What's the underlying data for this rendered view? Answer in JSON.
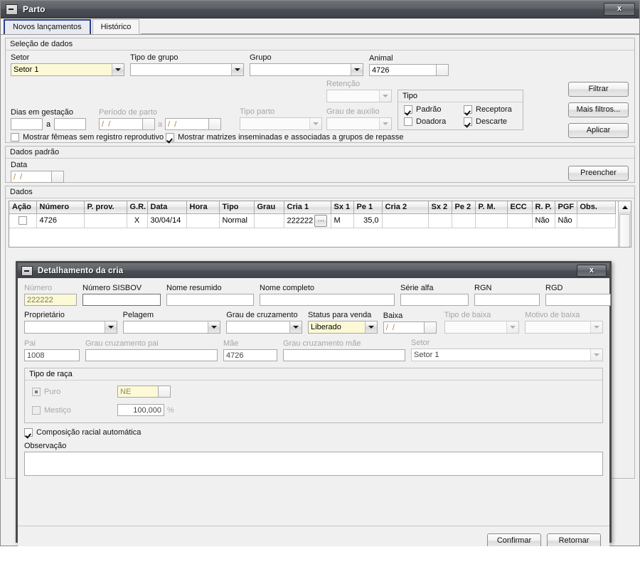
{
  "window": {
    "title": "Parto",
    "close_label": "x",
    "minimize_icon": "minimize-icon"
  },
  "tabs": [
    {
      "label": "Novos lançamentos",
      "active": true
    },
    {
      "label": "Histórico",
      "active": false
    }
  ],
  "selecao_de_dados": {
    "title": "Seleção de dados",
    "setor": {
      "label": "Setor",
      "value": "Setor 1"
    },
    "tipo_de_grupo": {
      "label": "Tipo de grupo",
      "value": ""
    },
    "grupo": {
      "label": "Grupo",
      "value": ""
    },
    "animal": {
      "label": "Animal",
      "value": "4726"
    },
    "dias_em_gestacao": {
      "label": "Dias em gestação",
      "from": "",
      "sep": "a",
      "to": ""
    },
    "periodo_de_parto": {
      "label": "Período de parto",
      "from": "/  /",
      "sep": "a",
      "to": "/  /"
    },
    "tipo_parto": {
      "label": "Tipo parto",
      "value": ""
    },
    "retencao": {
      "label": "Retenção",
      "value": ""
    },
    "grau_de_auxilio": {
      "label": "Grau de auxílio",
      "value": ""
    },
    "check_femeas": {
      "label": "Mostrar fêmeas sem registro reprodutivo",
      "checked": false
    },
    "check_matrizes": {
      "label": "Mostrar matrizes inseminadas e associadas a grupos de repasse",
      "checked": true
    },
    "tipo_box": {
      "title": "Tipo",
      "options": [
        {
          "label": "Padrão",
          "checked": true
        },
        {
          "label": "Receptora",
          "checked": true
        },
        {
          "label": "Doadora",
          "checked": false
        },
        {
          "label": "Descarte",
          "checked": true
        }
      ]
    },
    "buttons": [
      {
        "label": "Filtrar",
        "name": "filtrar-button"
      },
      {
        "label": "Mais filtros...",
        "name": "mais-filtros-button"
      },
      {
        "label": "Aplicar",
        "name": "aplicar-button"
      }
    ]
  },
  "dados_padrao": {
    "title": "Dados padrão",
    "data": {
      "label": "Data",
      "value": "/  /"
    },
    "preencher": {
      "label": "Preencher"
    }
  },
  "dados": {
    "title": "Dados",
    "columns": [
      "Ação",
      "Número",
      "P. prov.",
      "G.R.",
      "Data",
      "Hora",
      "Tipo",
      "Grau",
      "Cria 1",
      "Sx 1",
      "Pe 1",
      "Cria 2",
      "Sx 2",
      "Pe 2",
      "P. M.",
      "ECC",
      "R. P.",
      "PGF",
      "Obs."
    ],
    "rows": [
      {
        "acao": "",
        "numero": "4726",
        "p_prov": "",
        "gr": "X",
        "data": "30/04/14",
        "hora": "",
        "tipo": "Normal",
        "grau": "",
        "cria1": "222222",
        "cria1_button": "…",
        "sx1": "M",
        "pe1": "35,0",
        "cria2": "",
        "sx2": "",
        "pe2": "",
        "pm": "",
        "ecc": "",
        "rp": "Não",
        "pgf": "Não",
        "obs": ""
      }
    ]
  },
  "dialog": {
    "title": "Detalhamento da cria",
    "close_label": "x",
    "numero": {
      "label": "Número",
      "value": "222222",
      "disabled": true
    },
    "numero_sisbov": {
      "label": "Número SISBOV",
      "value": ""
    },
    "nome_resumido": {
      "label": "Nome resumido",
      "value": ""
    },
    "nome_completo": {
      "label": "Nome completo",
      "value": ""
    },
    "serie_alfa": {
      "label": "Série alfa",
      "value": ""
    },
    "rgn": {
      "label": "RGN",
      "value": ""
    },
    "rgd": {
      "label": "RGD",
      "value": ""
    },
    "proprietario": {
      "label": "Proprietário",
      "value": ""
    },
    "pelagem": {
      "label": "Pelagem",
      "value": ""
    },
    "grau_de_cruzamento": {
      "label": "Grau de cruzamento",
      "value": ""
    },
    "status_para_venda": {
      "label": "Status para venda",
      "value": "Liberado"
    },
    "baixa": {
      "label": "Baixa",
      "value": "/  /"
    },
    "tipo_de_baixa": {
      "label": "Tipo de baixa",
      "value": "",
      "disabled": true
    },
    "motivo_de_baixa": {
      "label": "Motivo de baixa",
      "value": "",
      "disabled": true
    },
    "pai": {
      "label": "Pai",
      "value": "1008",
      "disabled": true
    },
    "grau_cruzamento_pai": {
      "label": "Grau cruzamento pai",
      "value": "",
      "disabled": true
    },
    "mae": {
      "label": "Mãe",
      "value": "4726",
      "disabled": true
    },
    "grau_cruzamento_mae": {
      "label": "Grau cruzamento mãe",
      "value": "",
      "disabled": true
    },
    "setor": {
      "label": "Setor",
      "value": "Setor 1",
      "disabled": true
    },
    "tipo_de_raca": {
      "title": "Tipo de raça",
      "puro": {
        "label": "Puro",
        "selected": true,
        "value": "NE"
      },
      "mestico": {
        "label": "Mestiço",
        "selected": false,
        "value": "100,000",
        "unit": "%"
      }
    },
    "composicao_racial": {
      "label": "Composição racial automática",
      "checked": true
    },
    "observacao": {
      "label": "Observação",
      "value": ""
    },
    "confirmar": {
      "label": "Confirmar"
    },
    "retornar": {
      "label": "Retornar"
    }
  },
  "colors": {
    "highlight_field": "#fcfad6",
    "green_cell": "#d9f0dc",
    "active_tab_border": "#2c3e8f",
    "titlebar": "#4c5056"
  }
}
